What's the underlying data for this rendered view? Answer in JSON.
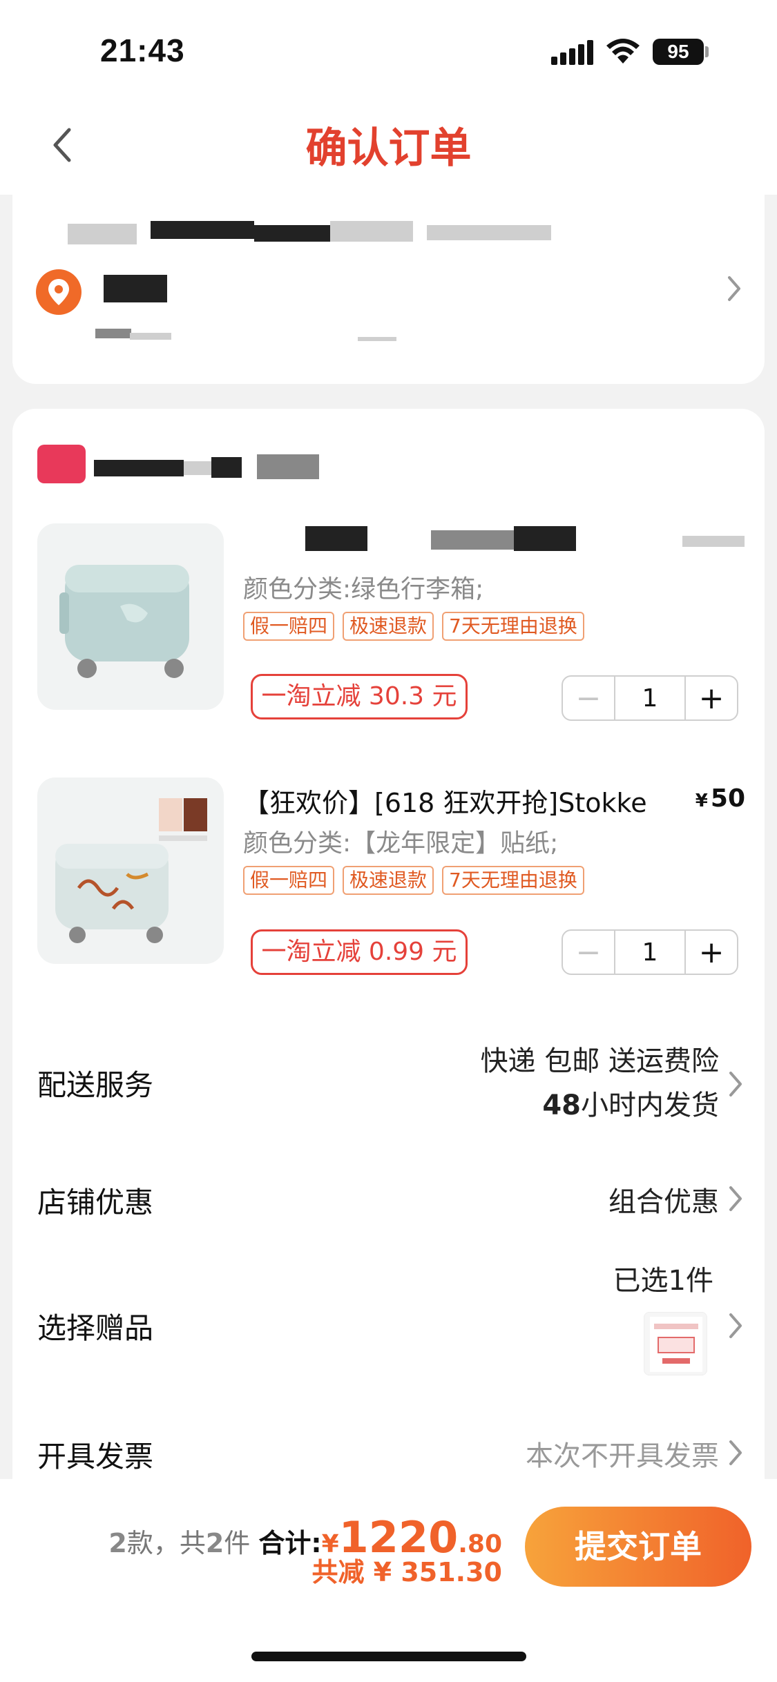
{
  "status_bar": {
    "time": "21:43",
    "battery": "95"
  },
  "nav": {
    "title": "确认订单"
  },
  "products": [
    {
      "title": "",
      "price": "",
      "spec": "颜色分类:绿色行李箱;",
      "tags": [
        "假一赔四",
        "极速退款",
        "7天无理由退换"
      ],
      "discount": "一淘立减 30.3 元",
      "quantity": "1"
    },
    {
      "title": "【狂欢价】[618 狂欢开抢]Stokke",
      "price_currency": "¥",
      "price": "50",
      "spec": "颜色分类:【龙年限定】贴纸;",
      "tags": [
        "假一赔四",
        "极速退款",
        "7天无理由退换"
      ],
      "discount": "一淘立减 0.99 元",
      "quantity": "1"
    }
  ],
  "stepper": {
    "minus": "−",
    "plus": "+"
  },
  "rows": {
    "delivery": {
      "label": "配送服务",
      "line1": "快递 包邮 送运费险",
      "line2_num": "48",
      "line2_text": "小时内发货"
    },
    "shop_discount": {
      "label": "店铺优惠",
      "value": "组合优惠"
    },
    "gift": {
      "label": "选择赠品",
      "value": "已选1件"
    },
    "invoice": {
      "label": "开具发票",
      "value": "本次不开具发票"
    }
  },
  "bottom": {
    "count_kinds": "2",
    "count_kinds_text": "款，共",
    "count_items": "2",
    "count_items_text": "件",
    "total_label": "合计:",
    "currency": "¥",
    "amount_int": "1220",
    "amount_dec": ".80",
    "saved": "共减 ¥ 351.30",
    "submit": "提交订单"
  },
  "colors": {
    "accent": "#e2412e",
    "orange": "#f0622a",
    "button_start": "#f7a33b"
  }
}
